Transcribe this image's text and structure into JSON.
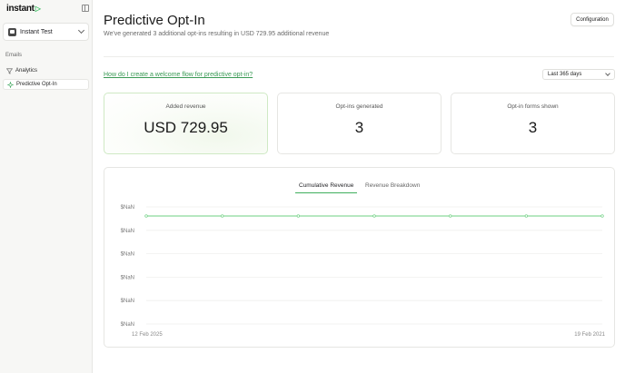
{
  "app": {
    "logo_text": "instant",
    "logo_mark": "▷"
  },
  "sidebar": {
    "store_name": "Instant Test",
    "section_label": "Emails",
    "items": [
      {
        "label": "Analytics",
        "icon": "filter-icon"
      },
      {
        "label": "Predictive Opt-In",
        "icon": "sparkle-icon",
        "active": true
      }
    ]
  },
  "header": {
    "title": "Predictive Opt-In",
    "subtitle": "We've generated 3 additional opt-ins resulting in USD 729.95 additional revenue",
    "config_label": "Configuration"
  },
  "help_link": "How do I create a welcome flow for predictive opt-in?",
  "date_filter": {
    "selected": "Last 365 days"
  },
  "stats": [
    {
      "label": "Added revenue",
      "value": "USD 729.95"
    },
    {
      "label": "Opt-ins generated",
      "value": "3"
    },
    {
      "label": "Opt-in forms shown",
      "value": "3"
    }
  ],
  "tabs": [
    {
      "label": "Cumulative Revenue",
      "active": true
    },
    {
      "label": "Revenue Breakdown",
      "active": false
    }
  ],
  "colors": {
    "accent": "#3fae5c",
    "line": "#6ccf80"
  },
  "chart_data": {
    "type": "line",
    "y_tick_labels": [
      "$NaN",
      "$NaN",
      "$NaN",
      "$NaN",
      "$NaN",
      "$NaN"
    ],
    "x_tick_labels": [
      "12 Feb 2025",
      "19 Feb 2021"
    ],
    "points": [
      0,
      0,
      0,
      0,
      0,
      0,
      0
    ],
    "grid": true
  }
}
